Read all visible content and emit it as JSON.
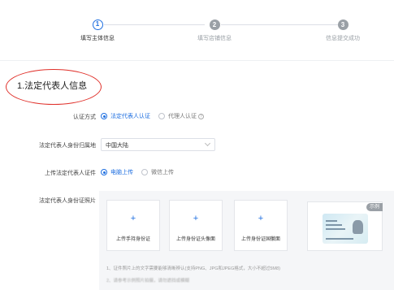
{
  "steps": [
    {
      "number": "1",
      "label": "填写主体信息",
      "state": "active"
    },
    {
      "number": "2",
      "label": "填写店铺信息",
      "state": "todo"
    },
    {
      "number": "3",
      "label": "信息提交成功",
      "state": "todo"
    }
  ],
  "section": {
    "title": "1.法定代表人信息"
  },
  "auth_method": {
    "label": "认证方式",
    "options": [
      {
        "label": "法定代表人认证",
        "selected": true
      },
      {
        "label": "代理人认证",
        "selected": false
      }
    ],
    "help_icon": "question-circle-icon"
  },
  "id_region": {
    "label": "法定代表人身份归属地",
    "value": "中国大陆"
  },
  "upload_cert": {
    "label": "上传法定代表人证件",
    "options": [
      {
        "label": "电脑上传",
        "selected": true
      },
      {
        "label": "微信上传",
        "selected": false
      }
    ]
  },
  "id_photos": {
    "label": "法定代表人身份证照片",
    "cards": [
      {
        "plus": "+",
        "label": "上传手持身份证"
      },
      {
        "plus": "+",
        "label": "上传身份证头像面"
      },
      {
        "plus": "+",
        "label": "上传身份证国徽面"
      }
    ],
    "sample_badge": "示例"
  },
  "notes": [
    "1、证件照片上的文字需要能够清晰辨认(支持PNG、JPG和JPEG格式，大小不超过5M8)",
    "2、请参考示例照片拍摄，请勿遮挡或模糊"
  ],
  "colors": {
    "accent": "#1f6fe0",
    "annotation": "#e0302a"
  }
}
